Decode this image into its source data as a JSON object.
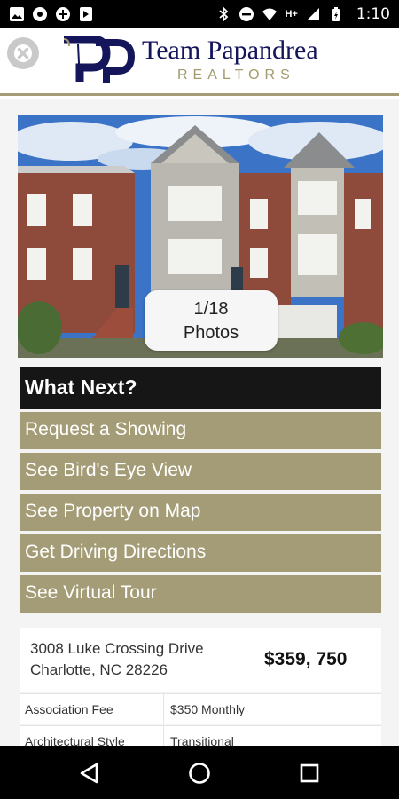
{
  "status_bar": {
    "time": "1:10",
    "network": "H+",
    "icons": [
      "gallery-icon",
      "circle-dot-icon",
      "plus-circle-icon",
      "flag-icon",
      "bluetooth-icon",
      "do-not-disturb-icon",
      "wifi-icon",
      "signal-icon",
      "battery-icon"
    ]
  },
  "header": {
    "brand_name": "Team Papandrea",
    "brand_sub": "REALTORS",
    "logo_icon": "pp-logo-icon",
    "close_icon": "close-icon",
    "colors": {
      "navy": "#15155c",
      "gold": "#a49c76"
    }
  },
  "photo": {
    "counter": "1/18",
    "counter_label": "Photos"
  },
  "what_next": {
    "heading": "What Next?",
    "items": [
      "Request a Showing",
      "See Bird's Eye View",
      "See Property on Map",
      "Get Driving Directions",
      "See Virtual Tour"
    ]
  },
  "listing": {
    "address_line1": "3008 Luke Crossing Drive",
    "address_line2": "Charlotte, NC 28226",
    "price": "$359, 750",
    "details": [
      {
        "label": "Association Fee",
        "value": "$350 Monthly"
      },
      {
        "label": "Architectural Style",
        "value": "Transitional"
      }
    ]
  },
  "nav": {
    "back_icon": "back-triangle-icon",
    "home_icon": "home-circle-icon",
    "recents_icon": "recents-square-icon"
  }
}
